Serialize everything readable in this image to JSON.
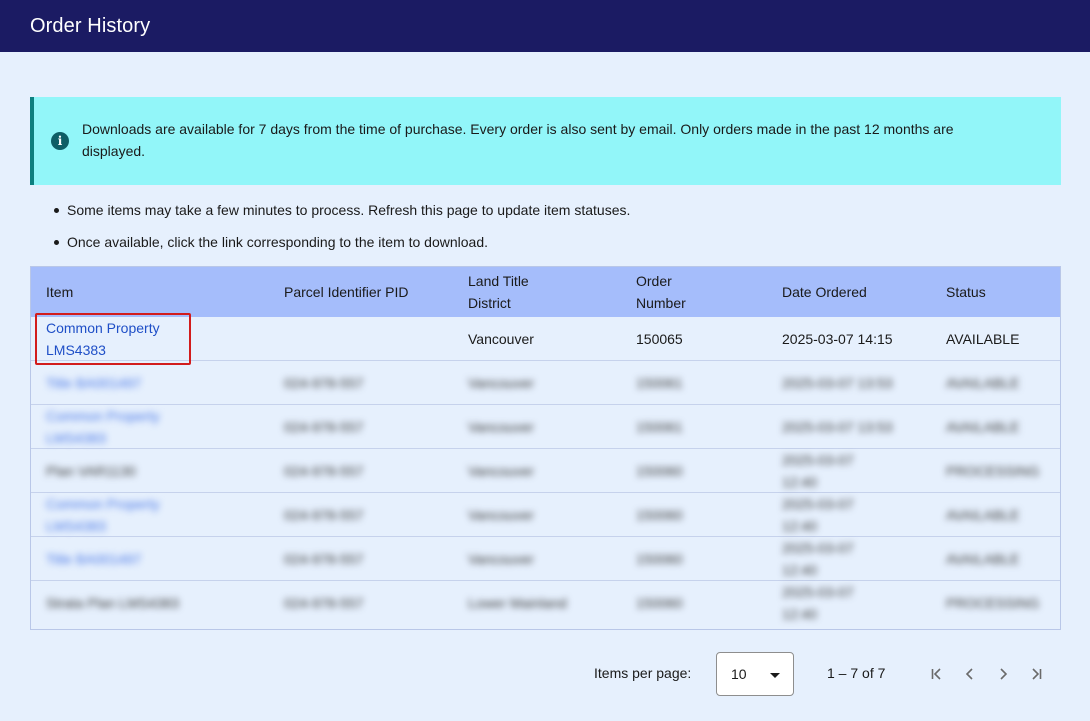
{
  "header": {
    "title": "Order History"
  },
  "info": {
    "icon": "info-icon",
    "text": "Downloads are available for 7 days from the time of purchase. Every order is also sent by email. Only orders made in the past 12 months are displayed."
  },
  "bullets": [
    "Some items may take a few minutes to process. Refresh this page to update item statuses.",
    "Once available, click the link corresponding to the item to download."
  ],
  "table": {
    "headers": {
      "item": "Item",
      "pid": "Parcel Identifier PID",
      "district": "Land Title District",
      "order": "Order Number",
      "date": "Date Ordered",
      "status": "Status"
    },
    "rows": [
      {
        "item": "Common Property LMS4383",
        "pid": "",
        "district": "Vancouver",
        "order": "150065",
        "date": "2025-03-07 14:15",
        "status": "AVAILABLE"
      },
      {
        "item": "Title BA001497",
        "pid": "024-978-557",
        "district": "Vancouver",
        "order": "150061",
        "date": "2025-03-07 13:53",
        "status": "AVAILABLE"
      },
      {
        "item": "Common Property LMS4383",
        "pid": "024-978-557",
        "district": "Vancouver",
        "order": "150061",
        "date": "2025-03-07 13:53",
        "status": "AVAILABLE"
      },
      {
        "item": "Plan VAR1130",
        "pid": "024-978-557",
        "district": "Vancouver",
        "order": "150060",
        "date": "2025-03-07 12:40",
        "status": "PROCESSING"
      },
      {
        "item": "Common Property LMS4383",
        "pid": "024-978-557",
        "district": "Vancouver",
        "order": "150060",
        "date": "2025-03-07 12:40",
        "status": "AVAILABLE"
      },
      {
        "item": "Title BA001497",
        "pid": "024-978-557",
        "district": "Vancouver",
        "order": "150060",
        "date": "2025-03-07 12:40",
        "status": "AVAILABLE"
      },
      {
        "item": "Strata Plan LMS4383",
        "pid": "024-978-557",
        "district": "Lower Mainland",
        "order": "150060",
        "date": "2025-03-07 12:40",
        "status": "PROCESSING"
      }
    ]
  },
  "pager": {
    "label": "Items per page:",
    "per_page": "10",
    "range": "1 – 7 of 7",
    "first_icon": "first-page-icon",
    "prev_icon": "chevron-left-icon",
    "next_icon": "chevron-right-icon",
    "last_icon": "last-page-icon"
  },
  "colors": {
    "header_bg": "#1b1b63",
    "banner_bg": "#92f6f9",
    "table_header_bg": "#a5bdfb",
    "link": "#1f4fc7",
    "highlight": "#d21c1c"
  }
}
